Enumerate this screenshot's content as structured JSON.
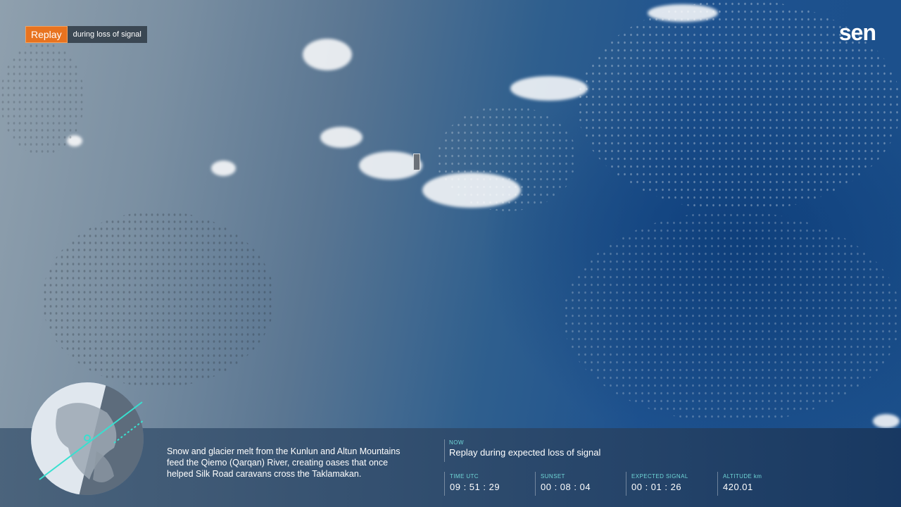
{
  "badge": {
    "primary": "Replay",
    "secondary": "during loss of signal"
  },
  "brand": {
    "logo_text": "sen"
  },
  "caption": {
    "text": "Snow and glacier melt from the Kunlun and Altun Mountains feed the Qiemo (Qarqan) River, creating oases that once helped Silk Road caravans cross the Taklamakan."
  },
  "now": {
    "label": "NOW",
    "value": "Replay during expected loss of signal"
  },
  "stats": [
    {
      "label": "TIME UTC",
      "value": "09 : 51 : 29"
    },
    {
      "label": "SUNSET",
      "value": "00 : 08 : 04"
    },
    {
      "label": "EXPECTED SIGNAL",
      "value": "00 : 01 : 26"
    },
    {
      "label": "ALTITUDE km",
      "value": "420.01"
    }
  ],
  "colors": {
    "accent": "#e8731f",
    "label_teal": "#6fd6d6",
    "orbit_line": "#38e0d0"
  }
}
